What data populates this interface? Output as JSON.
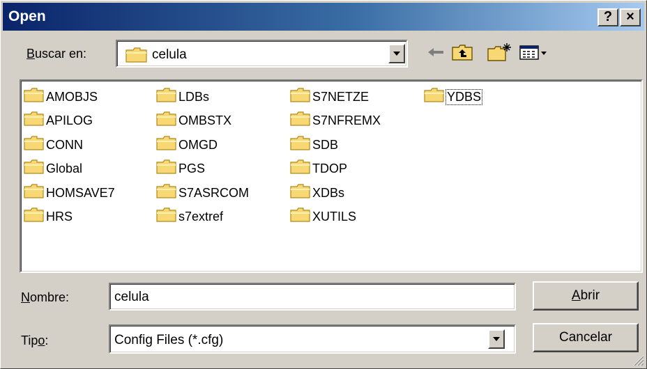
{
  "window": {
    "title": "Open",
    "help_glyph": "?",
    "close_glyph": "×"
  },
  "look_in": {
    "label_prefix": "",
    "label_accel": "B",
    "label_rest": "uscar en:",
    "value": "celula",
    "icon": "folder-icon"
  },
  "toolbar": {
    "items": [
      "back-arrow-icon",
      "up-folder-icon",
      "new-folder-icon",
      "view-menu-icon"
    ]
  },
  "files": {
    "columns": [
      [
        "AMOBJS",
        "APILOG",
        "CONN",
        "Global",
        "HOMSAVE7",
        "HRS"
      ],
      [
        "LDBs",
        "OMBSTX",
        "OMGD",
        "PGS",
        "S7ASRCOM",
        "s7extref"
      ],
      [
        "S7NETZE",
        "S7NFREMX",
        "SDB",
        "TDOP",
        "XDBs",
        "XUTILS"
      ],
      [
        "YDBS"
      ]
    ],
    "focused": "YDBS"
  },
  "filename": {
    "label_accel": "N",
    "label_rest": "ombre:",
    "value": "celula"
  },
  "filetype": {
    "label_prefix": "Tip",
    "label_accel": "o",
    "label_rest": ":",
    "value": "Config Files (*.cfg)"
  },
  "buttons": {
    "open_accel": "A",
    "open_rest": "brir",
    "cancel": "Cancelar"
  }
}
